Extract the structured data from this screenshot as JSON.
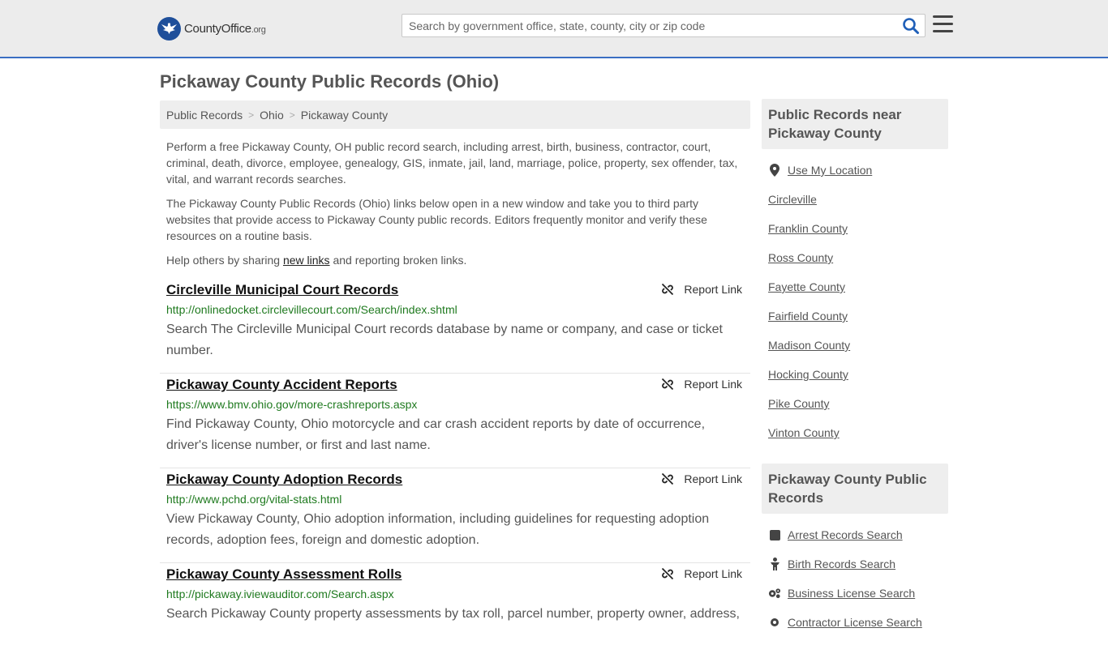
{
  "header": {
    "logo_main": "CountyOffice",
    "logo_suffix": ".org",
    "search_placeholder": "Search by government office, state, county, city or zip code"
  },
  "page_title": "Pickaway County Public Records (Ohio)",
  "breadcrumb": [
    "Public Records",
    "Ohio",
    "Pickaway County"
  ],
  "intro": {
    "p1": "Perform a free Pickaway County, OH public record search, including arrest, birth, business, contractor, court, criminal, death, divorce, employee, genealogy, GIS, inmate, jail, land, marriage, police, property, sex offender, tax, vital, and warrant records searches.",
    "p2": "The Pickaway County Public Records (Ohio) links below open in a new window and take you to third party websites that provide access to Pickaway County public records. Editors frequently monitor and verify these resources on a routine basis.",
    "p3_before": "Help others by sharing ",
    "p3_link": "new links",
    "p3_after": " and reporting broken links."
  },
  "report_label": "Report Link",
  "records": [
    {
      "title": "Circleville Municipal Court Records",
      "url": "http://onlinedocket.circlevillecourt.com/Search/index.shtml",
      "desc": "Search The Circleville Municipal Court records database by name or company, and case or ticket number."
    },
    {
      "title": "Pickaway County Accident Reports",
      "url": "https://www.bmv.ohio.gov/more-crashreports.aspx",
      "desc": "Find Pickaway County, Ohio motorcycle and car crash accident reports by date of occurrence, driver's license number, or first and last name."
    },
    {
      "title": "Pickaway County Adoption Records",
      "url": "http://www.pchd.org/vital-stats.html",
      "desc": "View Pickaway County, Ohio adoption information, including guidelines for requesting adoption records, adoption fees, foreign and domestic adoption."
    },
    {
      "title": "Pickaway County Assessment Rolls",
      "url": "http://pickaway.iviewauditor.com/Search.aspx",
      "desc": "Search Pickaway County property assessments by tax roll, parcel number, property owner, address,"
    }
  ],
  "sidebar": {
    "nearby_title": "Public Records near Pickaway County",
    "use_location": "Use My Location",
    "nearby": [
      "Circleville",
      "Franklin County",
      "Ross County",
      "Fayette County",
      "Fairfield County",
      "Madison County",
      "Hocking County",
      "Pike County",
      "Vinton County"
    ],
    "county_title": "Pickaway County Public Records",
    "county_links": [
      {
        "label": "Arrest Records Search",
        "icon": "square-icon"
      },
      {
        "label": "Birth Records Search",
        "icon": "baby-icon"
      },
      {
        "label": "Business License Search",
        "icon": "gears-icon"
      },
      {
        "label": "Contractor License Search",
        "icon": "gear-icon"
      }
    ]
  },
  "colors": {
    "accent_blue": "#3b6ec2",
    "url_green": "#1f7a1f",
    "logo_blue": "#1f4f9a"
  }
}
